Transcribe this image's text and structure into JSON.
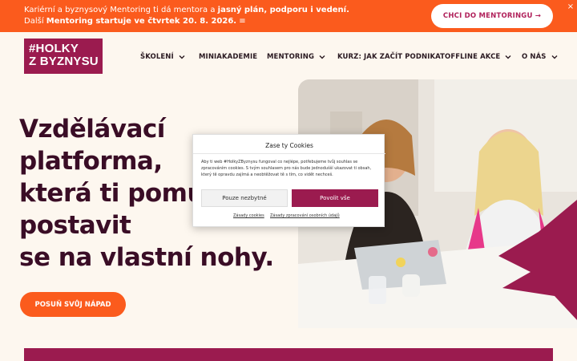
{
  "banner": {
    "text_prefix": "Kariérní a byznysový Mentoring ti dá mentora a ",
    "text_bold": "jasný plán, podporu i vedení.",
    "text_middle": " Další ",
    "text_bold_2": "Mentoring startuje ve čtvrtek 20. 8. 2026.",
    "text_suffix": " ",
    "cta_label": "CHCI DO MENTORINGU →",
    "close_label": "×"
  },
  "header": {
    "logo_line1": "#HOLKY",
    "logo_line2": "Z BYZNYSU",
    "nav": [
      {
        "label": "ŠKOLENÍ",
        "has_dropdown": true
      },
      {
        "label": "MINIAKADEMIE",
        "has_dropdown": false
      },
      {
        "label": "MENTORING",
        "has_dropdown": true
      },
      {
        "label": "KURZ: JAK ZAČÍT PODNIKAT",
        "has_dropdown": false
      },
      {
        "label": "OFFLINE AKCE",
        "has_dropdown": true
      },
      {
        "label": "O NÁS",
        "has_dropdown": true
      }
    ]
  },
  "hero": {
    "title_lines": [
      "Vzdělávací",
      "platforma,",
      "která ti pomůže",
      "postavit",
      "se na vlastní nohy."
    ],
    "cta_label": "POSUŇ SVŮJ NÁPAD"
  },
  "cookie": {
    "title": "Zase ty Cookies",
    "text": "Aby ti web #HolkyZByznysu fungoval co nejlépe, potřebujeme tvůj souhlas se zpracováním cookies. S tvým souhlasem pro nás bude jednodušší ukazovat ti obsah, který tě opravdu zajímá a neobtěžovat tě s tím, co vidět nechceš.",
    "deny_label": "Pouze nezbytné",
    "accept_label": "Povolit vše",
    "link_cookies": "Zásady cookies",
    "link_privacy": "Zásady zpracování osobních údajů"
  },
  "colors": {
    "orange": "#fb5b1d",
    "magenta": "#9b1b4f",
    "dark_plum": "#3a0d26",
    "cream": "#fdf7ef"
  }
}
